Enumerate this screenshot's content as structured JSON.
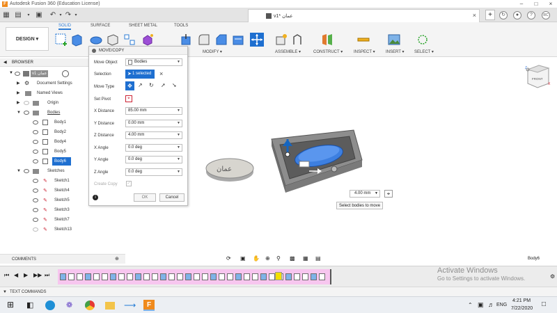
{
  "window": {
    "title": "Autodesk Fusion 360 (Education License)",
    "document_tab": "v1* عمان",
    "user_initials": "RC"
  },
  "ribbon": {
    "workspace": "DESIGN ▾",
    "tabs": [
      "SOLID",
      "SURFACE",
      "SHEET METAL",
      "TOOLS"
    ],
    "groups": [
      "MODIFY ▾",
      "ASSEMBLE ▾",
      "CONSTRUCT ▾",
      "INSPECT ▾",
      "INSERT ▾",
      "SELECT ▾"
    ]
  },
  "browser": {
    "header": "BROWSER",
    "root": "v1 عمان",
    "items": [
      {
        "label": "Document Settings"
      },
      {
        "label": "Named Views"
      },
      {
        "label": "Origin"
      },
      {
        "label": "Bodies"
      },
      {
        "label": "Body1"
      },
      {
        "label": "Body2"
      },
      {
        "label": "Body4"
      },
      {
        "label": "Body5"
      },
      {
        "label": "Body6"
      },
      {
        "label": "Sketches"
      },
      {
        "label": "Sketch1"
      },
      {
        "label": "Sketch4"
      },
      {
        "label": "Sketch5"
      },
      {
        "label": "Sketch3"
      },
      {
        "label": "Sketch7"
      },
      {
        "label": "Sketch13"
      }
    ]
  },
  "dialog": {
    "title": "MOVE/COPY",
    "move_object_label": "Move Object",
    "move_object_value": "Bodies",
    "selection_label": "Selection",
    "selection_value": "1 selected",
    "move_type_label": "Move Type",
    "set_pivot_label": "Set Pivot",
    "x_distance_label": "X Distance",
    "x_distance_value": "85.00 mm",
    "y_distance_label": "Y Distance",
    "y_distance_value": "0.00 mm",
    "z_distance_label": "Z Distance",
    "z_distance_value": "4.00 mm",
    "x_angle_label": "X Angle",
    "x_angle_value": "0.0 deg",
    "y_angle_label": "Y Angle",
    "y_angle_value": "0.0 deg",
    "z_angle_label": "Z Angle",
    "z_angle_value": "0.0 deg",
    "create_copy_label": "Create Copy",
    "ok_label": "OK",
    "cancel_label": "Cancel"
  },
  "canvas": {
    "value_input": "4.00 mm",
    "tooltip": "Select bodies to move",
    "viewcube_label": "FRONT",
    "plaque_text": "عمان"
  },
  "bottom": {
    "comments": "COMMENTS",
    "selection_name": "Body6",
    "text_commands": "TEXT COMMANDS",
    "watermark_title": "Activate Windows",
    "watermark_sub": "Go to Settings to activate Windows."
  },
  "taskbar": {
    "language": "ENG",
    "time": "4:21 PM",
    "date": "7/22/2020"
  },
  "colors": {
    "accent": "#1e6fd0",
    "timeline_track": "#f7c6ef",
    "model_gray": "#9a9a9a",
    "model_blue": "#3d7fe0"
  }
}
